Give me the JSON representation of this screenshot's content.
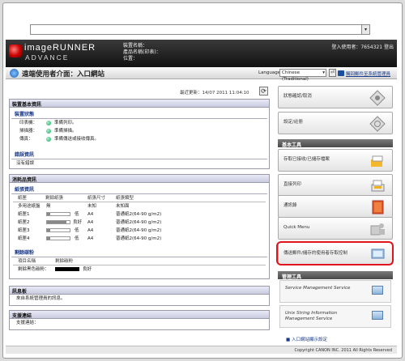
{
  "header": {
    "brand_line1": "imageRUNNER",
    "brand_line2": "ADVANCE",
    "device_name": "裝置名稱：",
    "product_name": "產品名稱(印表)：",
    "location": "位置：",
    "login_user": "登入使用者：7654321",
    "logout": "登出"
  },
  "toolbar": {
    "page_title": "遠端使用者介面：入口網站",
    "language_label": "Language:",
    "language_value": "Chinese (Traditional)",
    "portal_link": "觸回郵件至系統管理員"
  },
  "status": {
    "last_update": "最近更新：14/07 2011 11:04:10"
  },
  "device_basic": {
    "header": "裝置基本資訊",
    "sub": "裝置狀態",
    "rows": [
      {
        "label": "印表機：",
        "value": "準備列印。"
      },
      {
        "label": "掃描器：",
        "value": "準備掃描。"
      },
      {
        "label": "傳真：",
        "value": "準備傳送或接收傳真。"
      }
    ],
    "error_sub": "錯誤資訊",
    "error_text": "沒有錯誤"
  },
  "consumables": {
    "header": "消耗品資訊",
    "sub": "紙張資訊",
    "columns": [
      "紙匣",
      "剩餘紙張",
      "紙張尺寸",
      "紙張類型"
    ],
    "rows": [
      {
        "tray": "多用途紙盤",
        "remain": "無",
        "size": "未知",
        "type": "未知面"
      },
      {
        "tray": "紙匣1",
        "remain": "低",
        "size": "A4",
        "type": "普通紙2(64-90 g/m2)"
      },
      {
        "tray": "紙匣2",
        "remain": "良好",
        "size": "A4",
        "type": "普通紙2(64-90 g/m2)"
      },
      {
        "tray": "紙匣3",
        "remain": "低",
        "size": "A4",
        "type": "普通紙2(64-90 g/m2)"
      },
      {
        "tray": "紙匣4",
        "remain": "低",
        "size": "A4",
        "type": "普通紙2(64-90 g/m2)"
      }
    ],
    "toner_sub": "剩餘碳粉",
    "toner_columns": [
      "項目名稱",
      "剩餘碳粉"
    ],
    "toner_row": {
      "name": "剩餘黑色碳粉：",
      "level": "良好"
    }
  },
  "messages": {
    "header": "訊息板",
    "text": "來自系統管理員的訊息。"
  },
  "support": {
    "header": "支援連結",
    "text": "支援連結："
  },
  "side": {
    "card1": "狀態確認/取消",
    "card2": "設定/註冊",
    "basic_tools": "基本工具",
    "card3": "存取已接收/已儲存檔案",
    "card4": "直接列印",
    "card5": "通訊錄",
    "card6": "Quick Menu",
    "card7": "傳送郵件/儲存的使用者存取控制",
    "mgmt_tools": "管理工具",
    "mgmt1": "Service Management Service",
    "mgmt2": "Unix String Information Management Service",
    "portal_settings": "入口網站顯示設定"
  },
  "footer": {
    "copyright": "Copyright CANON INC. 2011 All Rights Reserved"
  },
  "colors": {
    "header_bg": "#1e1e1e",
    "accent": "#1a3a8a",
    "highlight": "#e0141b",
    "status_green": "#1aa862"
  }
}
